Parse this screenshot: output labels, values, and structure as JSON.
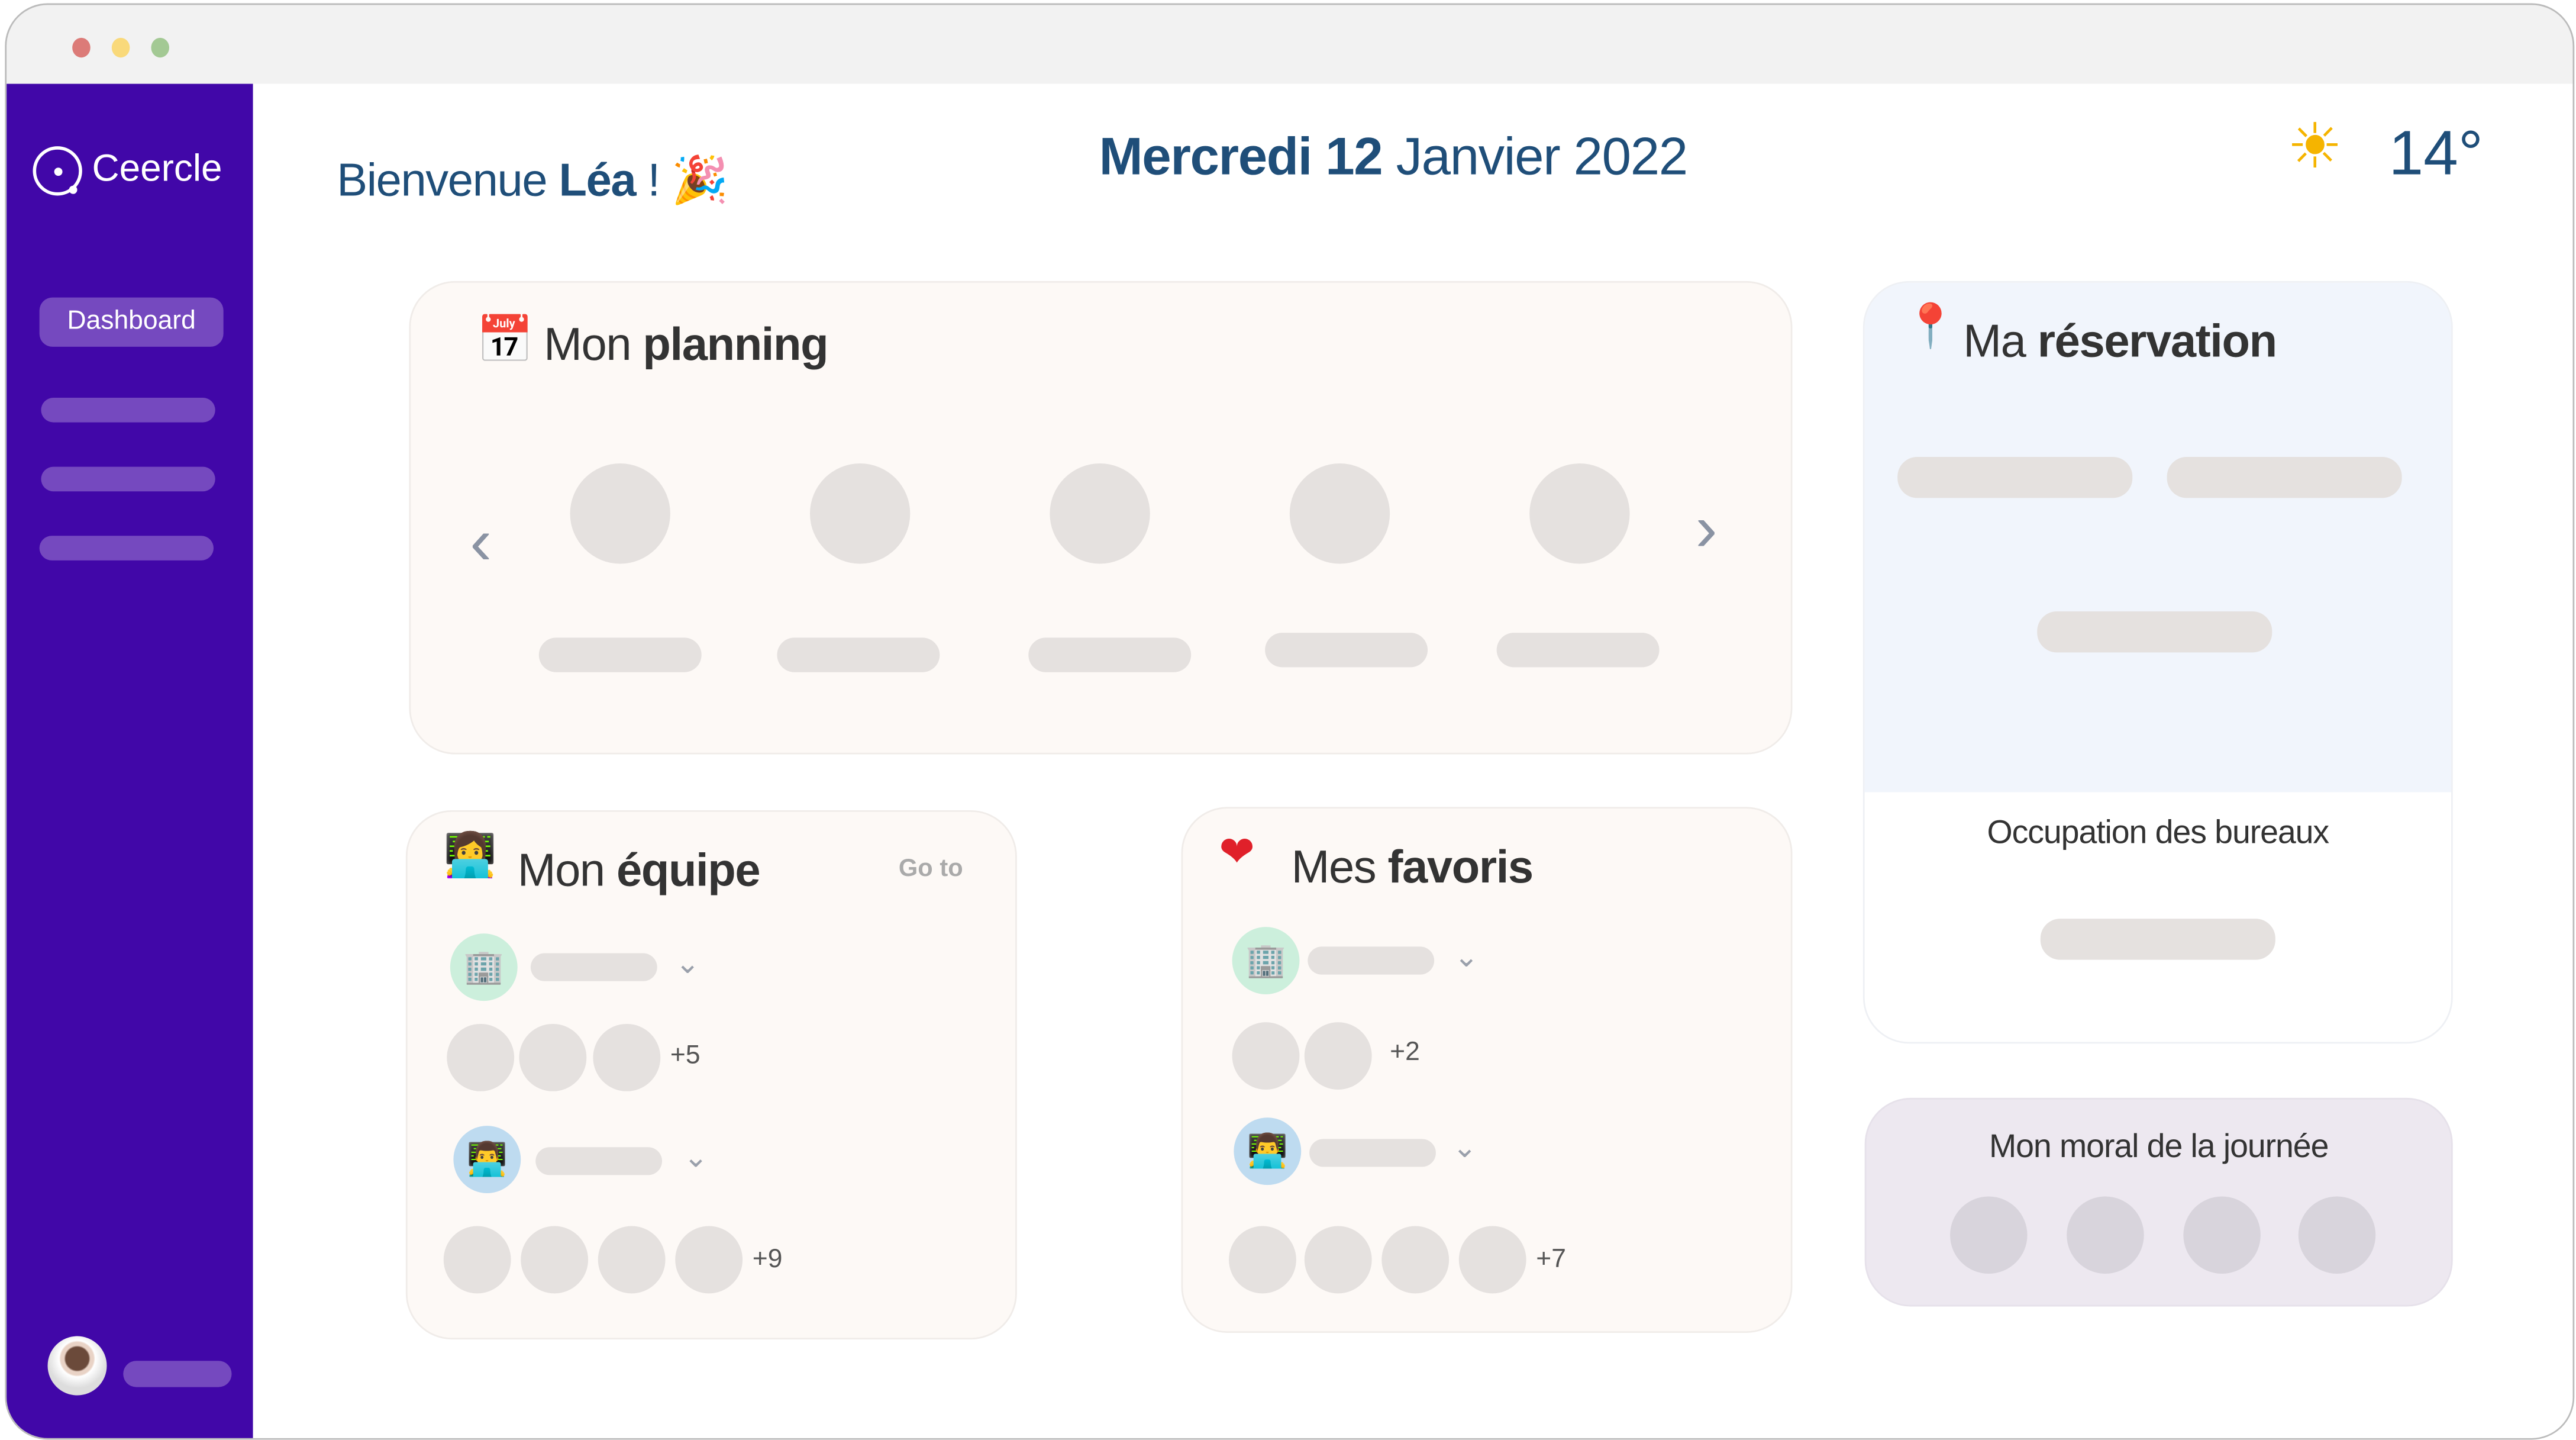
{
  "window": {
    "controls": [
      "close",
      "minimize",
      "maximize"
    ]
  },
  "sidebar": {
    "brand": "Ceercle",
    "active_item": "Dashboard",
    "placeholder_items": 3,
    "user": {
      "avatar": "user-photo"
    }
  },
  "header": {
    "greeting": "Bienvenue",
    "user_name": "Léa",
    "exclamation": "!",
    "greeting_icon": "party-popper-icon",
    "date_day": "Mercredi 12",
    "date_rest": "Janvier 2022",
    "weather_icon": "sun-icon",
    "temperature": "14°"
  },
  "planning": {
    "title_light": "Mon",
    "title_bold": "planning",
    "icon": "calendar-icon",
    "days": 5
  },
  "reservation": {
    "title_light": "Ma",
    "title_bold": "réservation",
    "icon": "pushpin-icon",
    "occupancy_label": "Occupation des bureaux"
  },
  "team": {
    "title_light": "Mon",
    "title_bold": "équipe",
    "icon": "woman-technologist-icon",
    "goto": "Go to",
    "groups": [
      {
        "icon": "office-building-icon",
        "extra": "+5",
        "avatars": 3
      },
      {
        "icon": "man-technologist-icon",
        "extra": "+9",
        "avatars": 4
      }
    ]
  },
  "favorites": {
    "title_light": "Mes",
    "title_bold": "favoris",
    "icon": "heart-icon",
    "groups": [
      {
        "icon": "office-building-icon",
        "extra": "+2",
        "avatars": 2
      },
      {
        "icon": "man-technologist-icon",
        "extra": "+7",
        "avatars": 4
      }
    ]
  },
  "mood": {
    "title": "Mon moral de la journée",
    "options": 4
  },
  "colors": {
    "sidebar": "#4107a8",
    "accent_pill": "#7549bf",
    "heading_blue": "#1f4e79",
    "placeholder": "#e5e1df"
  }
}
